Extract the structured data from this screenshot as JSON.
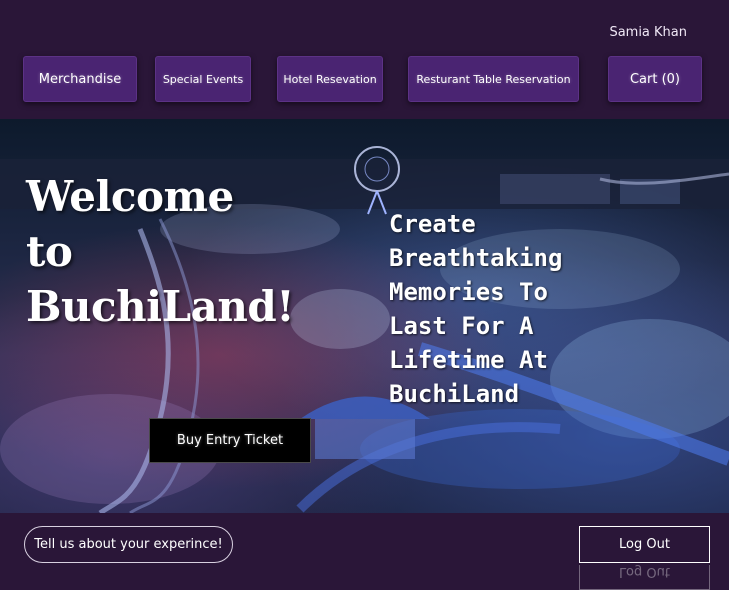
{
  "header": {
    "user_name": "Samia Khan"
  },
  "nav": {
    "merchandise": "Merchandise",
    "special_events": "Special Events",
    "hotel": "Hotel Resevation",
    "restaurant": "Resturant Table Reservation",
    "cart": "Cart (0)"
  },
  "hero": {
    "title_line1": "Welcome",
    "title_line2": "to",
    "title_line3": "BuchiLand!",
    "tagline": "Create Breathtaking Memories To Last For A Lifetime At BuchiLand",
    "buy_button": "Buy Entry Ticket"
  },
  "footer": {
    "feedback_button": "Tell us about your experince!",
    "logout_button": "Log Out"
  },
  "colors": {
    "background": "#2a1638",
    "nav_button": "#4a2472",
    "buy_button": "#000000"
  }
}
